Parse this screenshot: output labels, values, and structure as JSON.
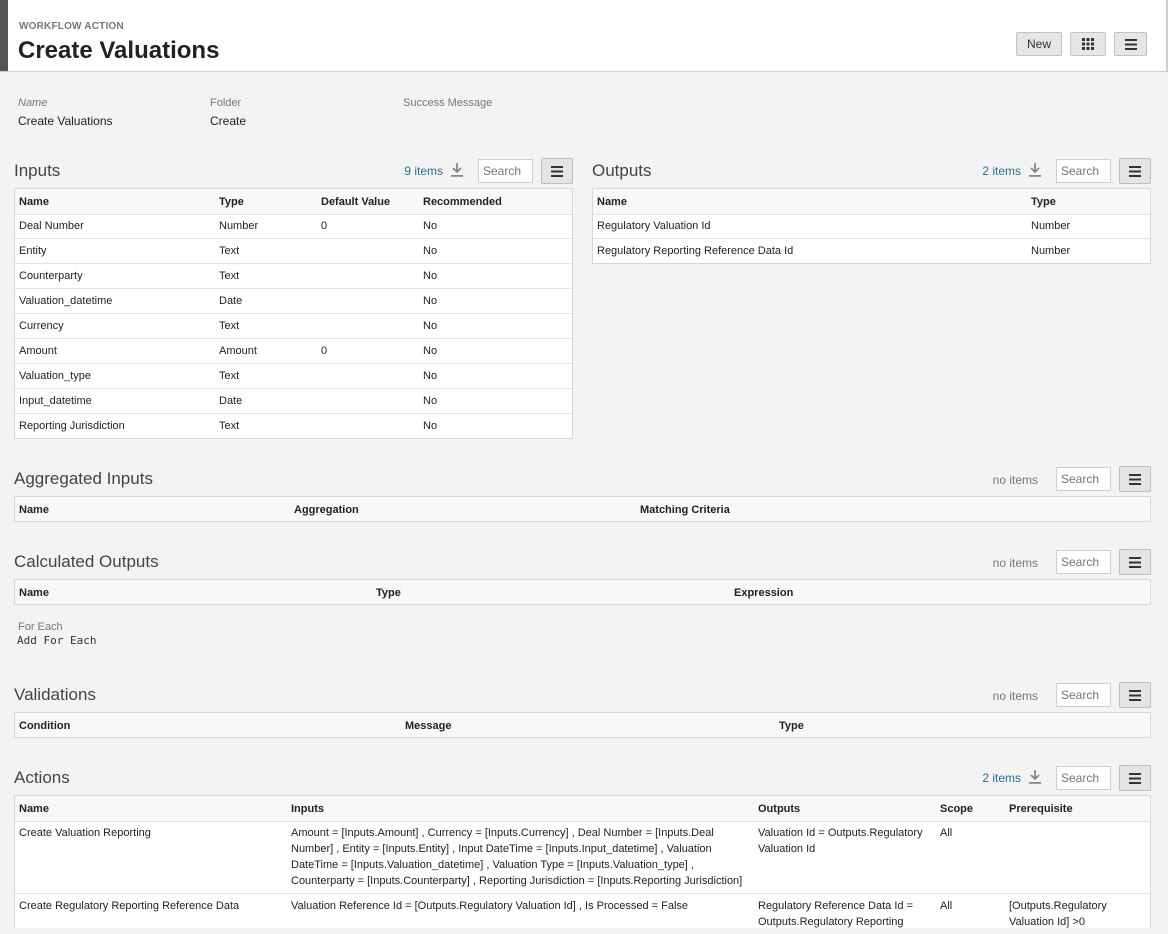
{
  "header": {
    "kicker": "WORKFLOW ACTION",
    "title": "Create Valuations",
    "new_label": "New"
  },
  "fields": [
    {
      "label": "Name",
      "value": "Create Valuations"
    },
    {
      "label": "Folder",
      "value": "Create"
    },
    {
      "label": "Success Message",
      "value": ""
    }
  ],
  "search_placeholder": "Search",
  "inputs": {
    "title": "Inputs",
    "count": "9 items",
    "columns": [
      "Name",
      "Type",
      "Default Value",
      "Recommended"
    ],
    "rows": [
      [
        "Deal Number",
        "Number",
        "0",
        "No"
      ],
      [
        "Entity",
        "Text",
        "",
        "No"
      ],
      [
        "Counterparty",
        "Text",
        "",
        "No"
      ],
      [
        "Valuation_datetime",
        "Date",
        "",
        "No"
      ],
      [
        "Currency",
        "Text",
        "",
        "No"
      ],
      [
        "Amount",
        "Amount",
        "0",
        "No"
      ],
      [
        "Valuation_type",
        "Text",
        "",
        "No"
      ],
      [
        "Input_datetime",
        "Date",
        "",
        "No"
      ],
      [
        "Reporting Jurisdiction",
        "Text",
        "",
        "No"
      ]
    ]
  },
  "outputs": {
    "title": "Outputs",
    "count": "2 items",
    "columns": [
      "Name",
      "Type"
    ],
    "rows": [
      [
        "Regulatory Valuation Id",
        "Number"
      ],
      [
        "Regulatory Reporting Reference Data Id",
        "Number"
      ]
    ]
  },
  "aggregated": {
    "title": "Aggregated Inputs",
    "count": "no items",
    "columns": [
      "Name",
      "Aggregation",
      "Matching Criteria"
    ]
  },
  "calculated": {
    "title": "Calculated Outputs",
    "count": "no items",
    "columns": [
      "Name",
      "Type",
      "Expression"
    ]
  },
  "for_each": {
    "label": "For Each",
    "add_label": "Add For Each"
  },
  "validations": {
    "title": "Validations",
    "count": "no items",
    "columns": [
      "Condition",
      "Message",
      "Type"
    ]
  },
  "actions": {
    "title": "Actions",
    "count": "2 items",
    "columns": [
      "Name",
      "Inputs",
      "Outputs",
      "Scope",
      "Prerequisite"
    ],
    "rows": [
      {
        "name": "Create Valuation Reporting",
        "inputs": [
          "Amount = [Inputs.Amount] , Currency = [Inputs.Currency] , Deal Number = [Inputs.Deal",
          "Number] , Entity = [Inputs.Entity] , Input DateTime = [Inputs.Input_datetime] , Valuation",
          "DateTime = [Inputs.Valuation_datetime] , Valuation Type = [Inputs.Valuation_type] ,",
          "Counterparty = [Inputs.Counterparty] , Reporting Jurisdiction = [Inputs.Reporting Jurisdiction]"
        ],
        "outputs": [
          "Valuation Id = Outputs.Regulatory",
          "Valuation Id"
        ],
        "scope": "All",
        "prerequisite": [
          "",
          ""
        ]
      },
      {
        "name": "Create Regulatory Reporting Reference Data",
        "inputs": [
          "Valuation Reference Id = [Outputs.Regulatory Valuation Id] , Is Processed = False",
          "",
          "",
          ""
        ],
        "outputs": [
          "Regulatory Reference Data Id =",
          "Outputs.Regulatory Reporting"
        ],
        "scope": "All",
        "prerequisite": [
          "[Outputs.Regulatory",
          "Valuation Id] >0"
        ]
      }
    ]
  }
}
